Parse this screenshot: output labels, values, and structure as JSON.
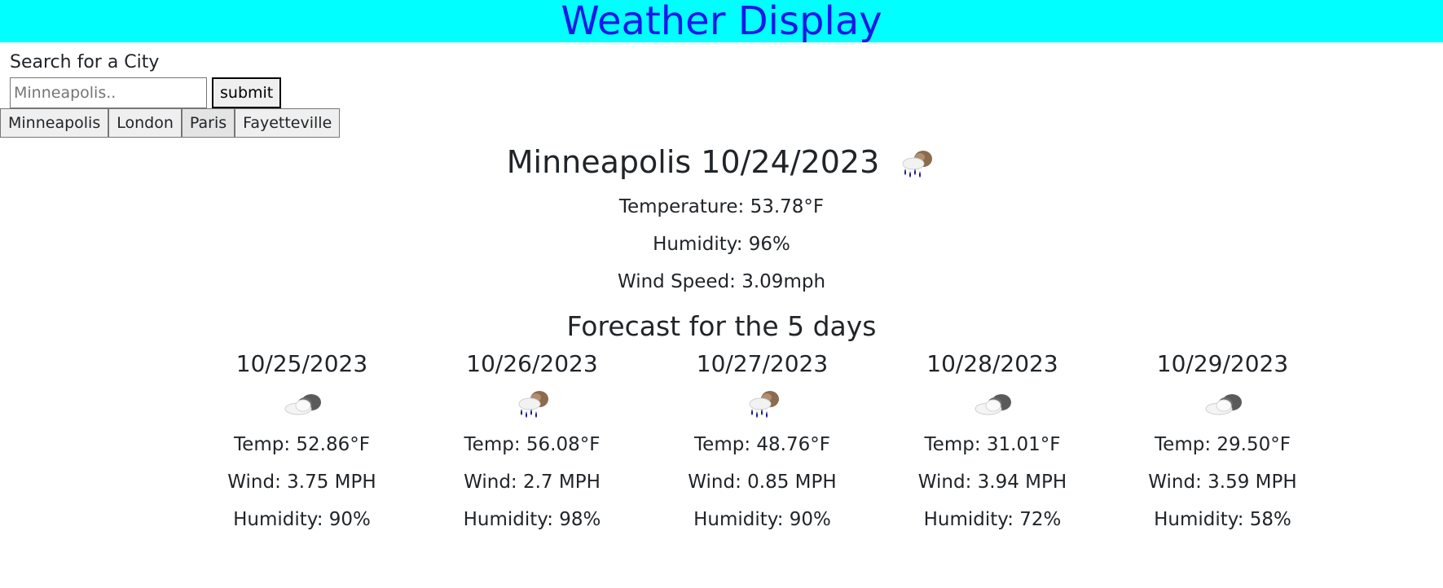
{
  "header": {
    "title": "Weather Display"
  },
  "search": {
    "label": "Search for a City",
    "placeholder": "Minneapolis..",
    "value": "",
    "submit_label": "submit"
  },
  "history": [
    "Minneapolis",
    "London",
    "Paris",
    "Fayetteville"
  ],
  "current": {
    "title": "Minneapolis 10/24/2023",
    "icon": "rain-cloud-icon",
    "temperature": "Temperature: 53.78°F",
    "humidity": "Humidity: 96%",
    "wind": "Wind Speed: 3.09mph"
  },
  "forecast": {
    "title": "Forecast for the 5 days",
    "days": [
      {
        "date": "10/25/2023",
        "icon": "cloud-icon",
        "temp": "Temp: 52.86°F",
        "wind": "Wind: 3.75 MPH",
        "humidity": "Humidity: 90%"
      },
      {
        "date": "10/26/2023",
        "icon": "rain-cloud-icon",
        "temp": "Temp: 56.08°F",
        "wind": "Wind: 2.7 MPH",
        "humidity": "Humidity: 98%"
      },
      {
        "date": "10/27/2023",
        "icon": "rain-cloud-icon",
        "temp": "Temp: 48.76°F",
        "wind": "Wind: 0.85 MPH",
        "humidity": "Humidity: 90%"
      },
      {
        "date": "10/28/2023",
        "icon": "cloud-icon",
        "temp": "Temp: 31.01°F",
        "wind": "Wind: 3.94 MPH",
        "humidity": "Humidity: 72%"
      },
      {
        "date": "10/29/2023",
        "icon": "cloud-icon",
        "temp": "Temp: 29.50°F",
        "wind": "Wind: 3.59 MPH",
        "humidity": "Humidity: 58%"
      }
    ]
  },
  "colors": {
    "header_bg": "#00ffff",
    "header_text": "#1818e8"
  }
}
